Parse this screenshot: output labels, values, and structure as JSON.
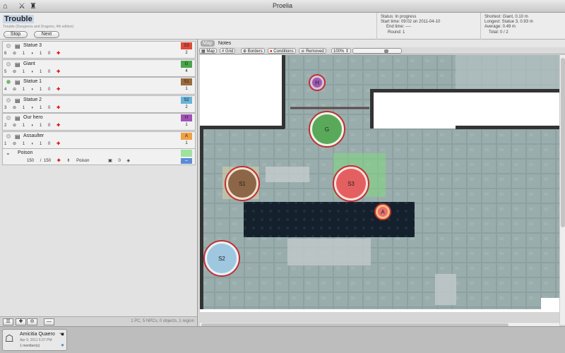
{
  "window": {
    "title": "Proelia"
  },
  "encounter": {
    "title": "Trouble",
    "subtitle": "Trouble (Dungeons and Dragons, 4th edition)",
    "stop_label": "Stop",
    "next_label": "Next"
  },
  "status": {
    "status": "Status: In progress",
    "start": "Start time: 09:02 on 2011-04-10",
    "end": "End time: ----",
    "round": "Round: 1"
  },
  "stats": {
    "shortest": "Shortest: Giant, 0.10 m",
    "longest": "Longest: Statue 3, 0.93 m",
    "average": "Average: 0.49 m",
    "total": "Total: 0 / 2"
  },
  "combatants": [
    {
      "name": "Statue 3",
      "initiative": "6",
      "hp": "1",
      "temp": "1",
      "other": "0",
      "badge": "S3",
      "badge_color": "#e04a3a",
      "order": "2",
      "active": false
    },
    {
      "name": "Giant",
      "initiative": "5",
      "hp": "1",
      "temp": "1",
      "other": "0",
      "badge": "G",
      "badge_color": "#4aa64a",
      "order": "4",
      "active": false
    },
    {
      "name": "Statue 1",
      "initiative": "4",
      "hp": "1",
      "temp": "1",
      "other": "0",
      "badge": "S1",
      "badge_color": "#9a6b3c",
      "order": "1",
      "active": true
    },
    {
      "name": "Statue 2",
      "initiative": "3",
      "hp": "1",
      "temp": "1",
      "other": "0",
      "badge": "S2",
      "badge_color": "#67b3d9",
      "order": "2",
      "active": false
    },
    {
      "name": "Our hero",
      "initiative": "2",
      "hp": "1",
      "temp": "1",
      "other": "0",
      "badge": "H",
      "badge_color": "#a050b8",
      "order": "1",
      "active": false
    },
    {
      "name": "Assaulter",
      "initiative": "1",
      "hp": "1",
      "temp": "1",
      "other": "0",
      "badge": "A",
      "badge_color": "#f0a040",
      "order": "1",
      "active": false
    }
  ],
  "condition": {
    "name": "Poison",
    "current": "150",
    "max": "150",
    "effect": "Poison",
    "duration": "0"
  },
  "list_footer": {
    "count": "1 PC, 5 NPCs, 0 objects, 1 region"
  },
  "player": {
    "name": "Amicitia Quaero",
    "date": "Apr 9, 2011 6:37 PM",
    "members": "1 member(s)"
  },
  "map": {
    "tabs": [
      "Map",
      "Notes"
    ],
    "tools": [
      "Map",
      "Grid",
      "Borders",
      "Conditions",
      "Removed"
    ],
    "zoom": "100%",
    "tokens": [
      {
        "label": "H",
        "color": "#9c5bb0",
        "ring": "#d8c0e0"
      },
      {
        "label": "G",
        "color": "#5aa85a",
        "ring": "#e9f5e9"
      },
      {
        "label": "S1",
        "color": "#8c6646",
        "ring": "#efe0d0"
      },
      {
        "label": "S3",
        "color": "#e46060",
        "ring": "#f9e0e0"
      },
      {
        "label": "A",
        "color": "#e87070",
        "ring": "#f5c080"
      },
      {
        "label": "S2",
        "color": "#9fc8e0",
        "ring": "#e6f2fa"
      }
    ]
  }
}
